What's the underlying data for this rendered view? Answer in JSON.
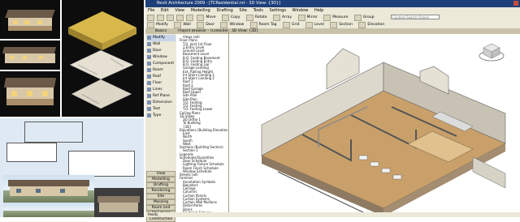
{
  "window": {
    "title": "Revit Architecture 2009 - [TCResidential.rvt - 3D View: {3D}]",
    "menu": [
      "File",
      "Edit",
      "View",
      "Modelling",
      "Drafting",
      "Site",
      "Tools",
      "Settings",
      "Window",
      "Help"
    ]
  },
  "toolbar1": {
    "labels": [
      "Move",
      "Copy",
      "Rotate",
      "Array",
      "Mirror",
      "Measure",
      "Group"
    ],
    "search_placeholder": "Content Search Online"
  },
  "toolbar2": {
    "labels": [
      "Modify",
      "Wall",
      "Door",
      "Window",
      "Room Tag",
      "Grid",
      "Level"
    ]
  },
  "toolbar3": {
    "labels": [
      "Basics",
      "Section",
      "Elevation"
    ]
  },
  "design_bar": {
    "header": "Basics",
    "tools": [
      "Modify",
      "Wall",
      "Door",
      "Window",
      "Component",
      "Room",
      "Roof",
      "Floor",
      "Lines",
      "Ref Plane",
      "Dimension",
      "Text",
      "Type"
    ],
    "tabs": [
      "View",
      "Modelling",
      "Drafting",
      "Rendering",
      "Site",
      "Massing",
      "Room and Area",
      "Structural",
      "Construction"
    ]
  },
  "project_browser": {
    "header": "Project Browser - TCResidential.rvt",
    "items": [
      "Views (all)",
      "Floor Plans",
      "T.O. Joist 1st Floor",
      "2.Entry Level",
      "Ground Level",
      "Basement Level",
      "B.O. Footing Basement",
      "B.O. Footing Entry",
      "B.O. Footing Gar",
      "Garage Landing",
      "Ext. Railing Height",
      "Int Stairs Landing 1",
      "Int Stairs Landing 2",
      "Roof 1",
      "Roof 2",
      "Roof Garage",
      "Roof Upper",
      "Site Plan",
      "Site-Plan",
      "T.O. Footing",
      "T.O. Footing",
      "T.O. Footing Lower",
      "Ceiling Plans",
      "3D Views",
      "3D Ortho 1",
      "To Building",
      "{3D}",
      "Elevations (Building Elevation)",
      "East",
      "North",
      "South",
      "West",
      "Sections (Building Section)",
      "Section 1",
      "Legends",
      "Schedules/Quantities",
      "Door Schedule",
      "Lighting Fixture Schedule",
      "Room Finish Schedule",
      "Window Schedule",
      "Sheets (all)",
      "Families",
      "Annotation Symbols",
      "Balusters",
      "Ceilings",
      "Columns",
      "Curtain Panels",
      "Curtain Systems",
      "Curtain Wall Mullions",
      "Detail Items",
      "Doors",
      "Electrical Fixtures",
      "Floors",
      "Lighting Fixtures"
    ]
  },
  "view_tab": "3D View: {3D}",
  "status": "Ready"
}
